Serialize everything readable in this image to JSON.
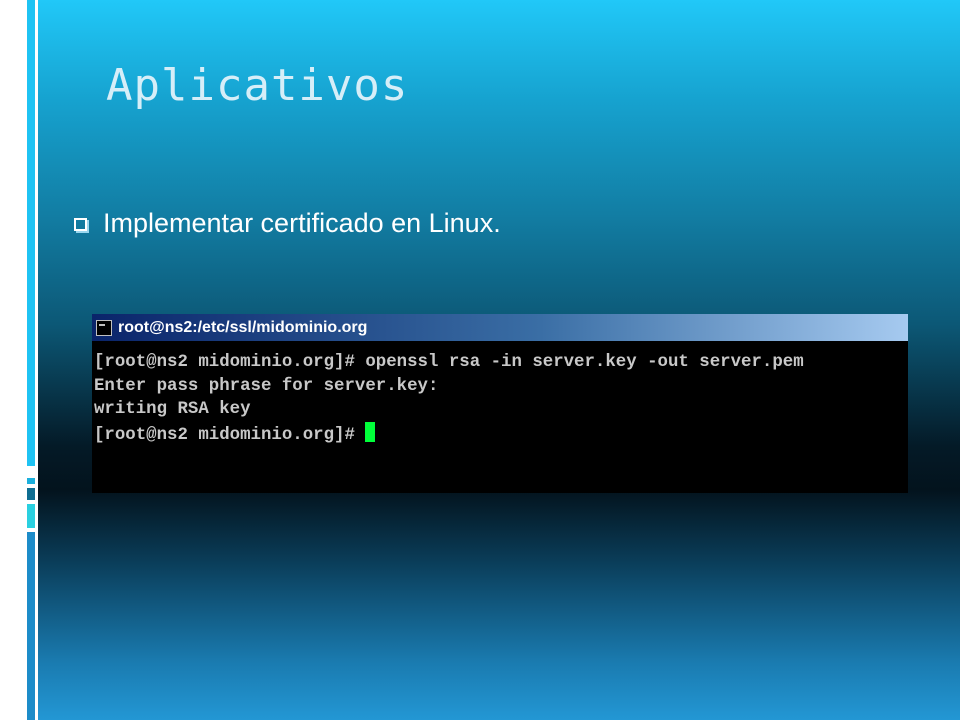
{
  "slide": {
    "title": "Aplicativos",
    "bullet": "Implementar certificado en Linux."
  },
  "terminal": {
    "window_title": "root@ns2:/etc/ssl/midominio.org",
    "lines": [
      "[root@ns2 midominio.org]# openssl rsa -in server.key -out server.pem",
      "Enter pass phrase for server.key:",
      "writing RSA key",
      "[root@ns2 midominio.org]#"
    ],
    "cursor_color": "#00ff3a"
  },
  "colors": {
    "accent": "#21c8f8",
    "rail": "#ffffff"
  },
  "icons": {
    "bullet": "checkbox-square-icon",
    "terminal": "terminal-window-icon"
  }
}
